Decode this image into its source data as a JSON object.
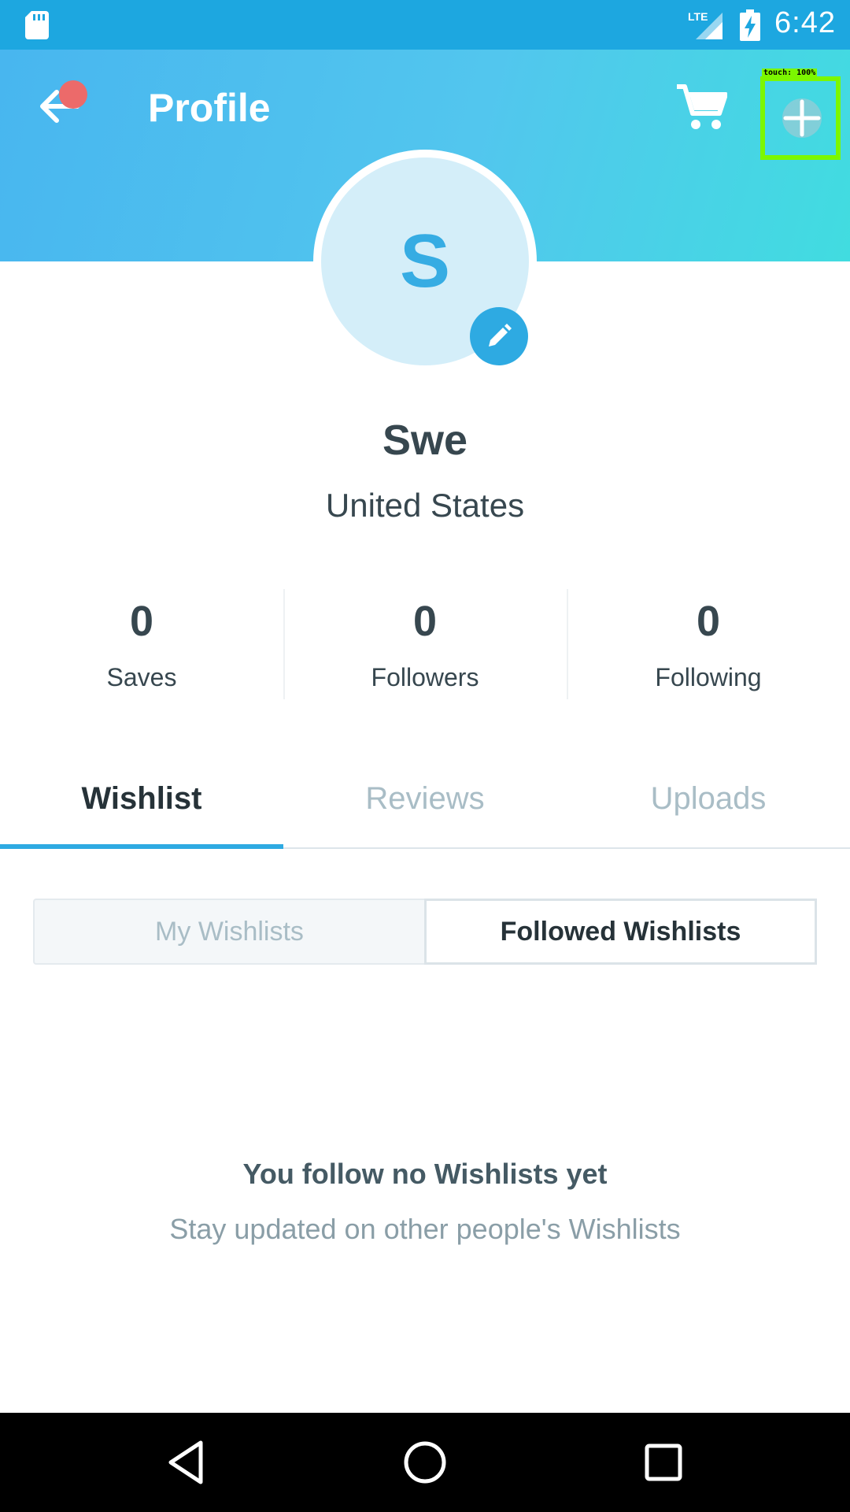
{
  "status_bar": {
    "time": "6:42",
    "network": "LTE",
    "icons": [
      "sd-card-icon",
      "signal-icon",
      "battery-charging-icon"
    ]
  },
  "header": {
    "title": "Profile",
    "back_icon": "arrow-left-icon",
    "cart_icon": "cart-icon",
    "add_icon": "plus-icon",
    "touch_indicator": "touch: 100%"
  },
  "profile": {
    "avatar_letter": "S",
    "name": "Swe",
    "location": "United States",
    "edit_icon": "pencil-icon"
  },
  "stats": [
    {
      "value": "0",
      "label": "Saves"
    },
    {
      "value": "0",
      "label": "Followers"
    },
    {
      "value": "0",
      "label": "Following"
    }
  ],
  "tabs": [
    {
      "label": "Wishlist",
      "active": true
    },
    {
      "label": "Reviews",
      "active": false
    },
    {
      "label": "Uploads",
      "active": false
    }
  ],
  "segmented": {
    "options": [
      "My Wishlists",
      "Followed Wishlists"
    ],
    "selected": "Followed Wishlists"
  },
  "empty_state": {
    "title": "You follow no Wishlists yet",
    "subtitle": "Stay updated on other people's Wishlists"
  },
  "colors": {
    "accent": "#2eaae2",
    "status_bar": "#1da7e0",
    "notification_dot": "#ec6a6a",
    "touch_highlight": "#7cf700"
  }
}
